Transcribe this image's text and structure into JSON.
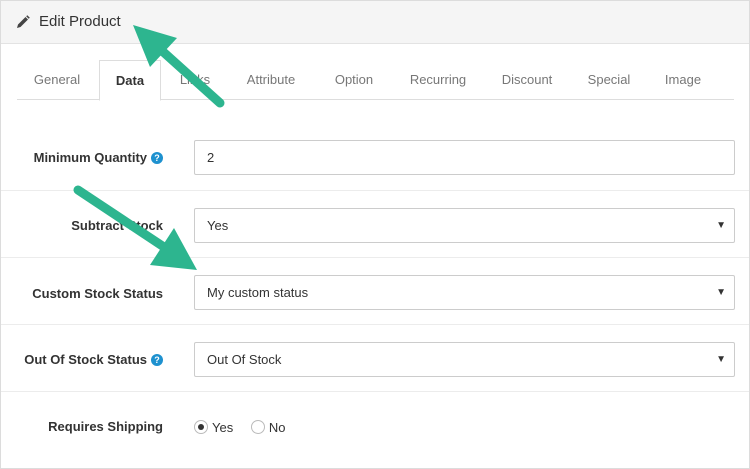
{
  "header": {
    "title": "Edit Product",
    "icon": "pencil-icon"
  },
  "tabs": [
    {
      "label": "General",
      "active": false
    },
    {
      "label": "Data",
      "active": true
    },
    {
      "label": "Links",
      "active": false
    },
    {
      "label": "Attribute",
      "active": false
    },
    {
      "label": "Option",
      "active": false
    },
    {
      "label": "Recurring",
      "active": false
    },
    {
      "label": "Discount",
      "active": false
    },
    {
      "label": "Special",
      "active": false
    },
    {
      "label": "Image",
      "active": false
    }
  ],
  "form": {
    "minimum_quantity": {
      "label": "Minimum Quantity",
      "value": "2"
    },
    "subtract_stock": {
      "label": "Subtract Stock",
      "value": "Yes"
    },
    "custom_stock_status": {
      "label": "Custom Stock Status",
      "value": "My custom status"
    },
    "out_of_stock_status": {
      "label": "Out Of Stock Status",
      "value": "Out Of Stock"
    },
    "requires_shipping": {
      "label": "Requires Shipping",
      "yes_label": "Yes",
      "no_label": "No",
      "selected": "Yes"
    }
  },
  "help_glyph": "?",
  "colors": {
    "help": "#1e91cf",
    "annotation_arrow": "#2db58f"
  }
}
